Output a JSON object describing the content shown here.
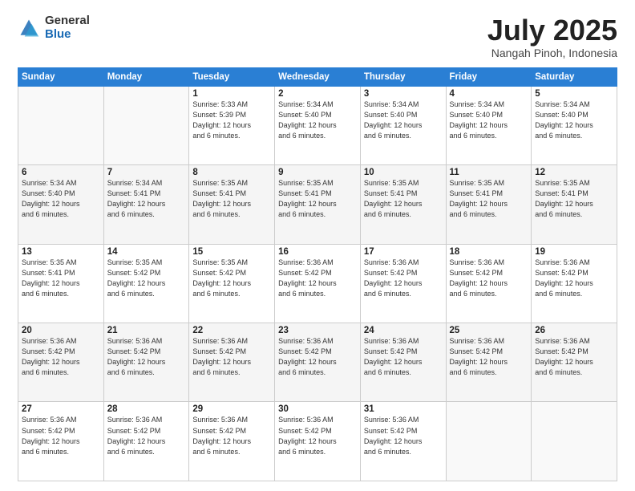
{
  "logo": {
    "general": "General",
    "blue": "Blue"
  },
  "header": {
    "month": "July 2025",
    "location": "Nangah Pinoh, Indonesia"
  },
  "weekdays": [
    "Sunday",
    "Monday",
    "Tuesday",
    "Wednesday",
    "Thursday",
    "Friday",
    "Saturday"
  ],
  "weeks": [
    [
      {
        "day": "",
        "info": ""
      },
      {
        "day": "",
        "info": ""
      },
      {
        "day": "1",
        "info": "Sunrise: 5:33 AM\nSunset: 5:39 PM\nDaylight: 12 hours\nand 6 minutes."
      },
      {
        "day": "2",
        "info": "Sunrise: 5:34 AM\nSunset: 5:40 PM\nDaylight: 12 hours\nand 6 minutes."
      },
      {
        "day": "3",
        "info": "Sunrise: 5:34 AM\nSunset: 5:40 PM\nDaylight: 12 hours\nand 6 minutes."
      },
      {
        "day": "4",
        "info": "Sunrise: 5:34 AM\nSunset: 5:40 PM\nDaylight: 12 hours\nand 6 minutes."
      },
      {
        "day": "5",
        "info": "Sunrise: 5:34 AM\nSunset: 5:40 PM\nDaylight: 12 hours\nand 6 minutes."
      }
    ],
    [
      {
        "day": "6",
        "info": "Sunrise: 5:34 AM\nSunset: 5:40 PM\nDaylight: 12 hours\nand 6 minutes."
      },
      {
        "day": "7",
        "info": "Sunrise: 5:34 AM\nSunset: 5:41 PM\nDaylight: 12 hours\nand 6 minutes."
      },
      {
        "day": "8",
        "info": "Sunrise: 5:35 AM\nSunset: 5:41 PM\nDaylight: 12 hours\nand 6 minutes."
      },
      {
        "day": "9",
        "info": "Sunrise: 5:35 AM\nSunset: 5:41 PM\nDaylight: 12 hours\nand 6 minutes."
      },
      {
        "day": "10",
        "info": "Sunrise: 5:35 AM\nSunset: 5:41 PM\nDaylight: 12 hours\nand 6 minutes."
      },
      {
        "day": "11",
        "info": "Sunrise: 5:35 AM\nSunset: 5:41 PM\nDaylight: 12 hours\nand 6 minutes."
      },
      {
        "day": "12",
        "info": "Sunrise: 5:35 AM\nSunset: 5:41 PM\nDaylight: 12 hours\nand 6 minutes."
      }
    ],
    [
      {
        "day": "13",
        "info": "Sunrise: 5:35 AM\nSunset: 5:41 PM\nDaylight: 12 hours\nand 6 minutes."
      },
      {
        "day": "14",
        "info": "Sunrise: 5:35 AM\nSunset: 5:42 PM\nDaylight: 12 hours\nand 6 minutes."
      },
      {
        "day": "15",
        "info": "Sunrise: 5:35 AM\nSunset: 5:42 PM\nDaylight: 12 hours\nand 6 minutes."
      },
      {
        "day": "16",
        "info": "Sunrise: 5:36 AM\nSunset: 5:42 PM\nDaylight: 12 hours\nand 6 minutes."
      },
      {
        "day": "17",
        "info": "Sunrise: 5:36 AM\nSunset: 5:42 PM\nDaylight: 12 hours\nand 6 minutes."
      },
      {
        "day": "18",
        "info": "Sunrise: 5:36 AM\nSunset: 5:42 PM\nDaylight: 12 hours\nand 6 minutes."
      },
      {
        "day": "19",
        "info": "Sunrise: 5:36 AM\nSunset: 5:42 PM\nDaylight: 12 hours\nand 6 minutes."
      }
    ],
    [
      {
        "day": "20",
        "info": "Sunrise: 5:36 AM\nSunset: 5:42 PM\nDaylight: 12 hours\nand 6 minutes."
      },
      {
        "day": "21",
        "info": "Sunrise: 5:36 AM\nSunset: 5:42 PM\nDaylight: 12 hours\nand 6 minutes."
      },
      {
        "day": "22",
        "info": "Sunrise: 5:36 AM\nSunset: 5:42 PM\nDaylight: 12 hours\nand 6 minutes."
      },
      {
        "day": "23",
        "info": "Sunrise: 5:36 AM\nSunset: 5:42 PM\nDaylight: 12 hours\nand 6 minutes."
      },
      {
        "day": "24",
        "info": "Sunrise: 5:36 AM\nSunset: 5:42 PM\nDaylight: 12 hours\nand 6 minutes."
      },
      {
        "day": "25",
        "info": "Sunrise: 5:36 AM\nSunset: 5:42 PM\nDaylight: 12 hours\nand 6 minutes."
      },
      {
        "day": "26",
        "info": "Sunrise: 5:36 AM\nSunset: 5:42 PM\nDaylight: 12 hours\nand 6 minutes."
      }
    ],
    [
      {
        "day": "27",
        "info": "Sunrise: 5:36 AM\nSunset: 5:42 PM\nDaylight: 12 hours\nand 6 minutes."
      },
      {
        "day": "28",
        "info": "Sunrise: 5:36 AM\nSunset: 5:42 PM\nDaylight: 12 hours\nand 6 minutes."
      },
      {
        "day": "29",
        "info": "Sunrise: 5:36 AM\nSunset: 5:42 PM\nDaylight: 12 hours\nand 6 minutes."
      },
      {
        "day": "30",
        "info": "Sunrise: 5:36 AM\nSunset: 5:42 PM\nDaylight: 12 hours\nand 6 minutes."
      },
      {
        "day": "31",
        "info": "Sunrise: 5:36 AM\nSunset: 5:42 PM\nDaylight: 12 hours\nand 6 minutes."
      },
      {
        "day": "",
        "info": ""
      },
      {
        "day": "",
        "info": ""
      }
    ]
  ]
}
